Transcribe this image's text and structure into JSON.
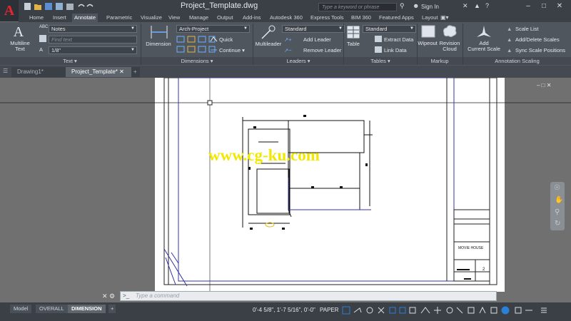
{
  "window": {
    "title": "Project_Template.dwg",
    "search_placeholder": "Type a keyword or phrase",
    "sign_in": "Sign In"
  },
  "ribbon_tabs": [
    "Home",
    "Insert",
    "Annotate",
    "Parametric",
    "Visualize",
    "View",
    "Manage",
    "Output",
    "Add-ins",
    "Autodesk 360",
    "Express Tools",
    "BIM 360",
    "Featured Apps",
    "Layout"
  ],
  "active_tab": "Annotate",
  "text_panel": {
    "multiline_text": "Multiline\nText",
    "style": "Notes",
    "find_placeholder": "Find text",
    "height": "1/8\"",
    "title": "Text"
  },
  "dimensions_panel": {
    "dimension": "Dimension",
    "style": "Arch-Project",
    "quick": "Quick",
    "continue": "Continue",
    "title": "Dimensions"
  },
  "leaders_panel": {
    "multileader": "Multileader",
    "style": "Standard",
    "add_leader": "Add Leader",
    "remove_leader": "Remove Leader",
    "title": "Leaders"
  },
  "tables_panel": {
    "table": "Table",
    "style": "Standard",
    "extract_data": "Extract Data",
    "link_data": "Link Data",
    "title": "Tables"
  },
  "markup_panel": {
    "wipeout": "Wipeout",
    "revision_cloud": "Revision\nCloud",
    "title": "Markup"
  },
  "annotation_scaling_panel": {
    "add_current_scale": "Add\nCurrent Scale",
    "scale_list": "Scale List",
    "add_delete_scales": "Add/Delete Scales",
    "sync_scale_positions": "Sync Scale Positions",
    "title": "Annotation Scaling"
  },
  "file_tabs": [
    "Drawing1*",
    "Project_Template*"
  ],
  "active_file": "Project_Template*",
  "title_block": {
    "project_name": "MOVIE HOUSE",
    "sheet_number": "2"
  },
  "watermark": "www.cg-ku.com",
  "command_line": {
    "placeholder": "Type a command"
  },
  "layout_tabs": [
    "Model",
    "OVERALL",
    "DIMENSION"
  ],
  "active_layout": "DIMENSION",
  "status": {
    "coordinates": "0'-4 5/8\", 1'-7 5/16\", 0'-0\"",
    "space": "PAPER"
  },
  "colors": {
    "app_red": "#e8242c",
    "ribbon_bg": "#50565e",
    "paper": "#ffffff",
    "accent_blue": "#2a7fd6"
  }
}
